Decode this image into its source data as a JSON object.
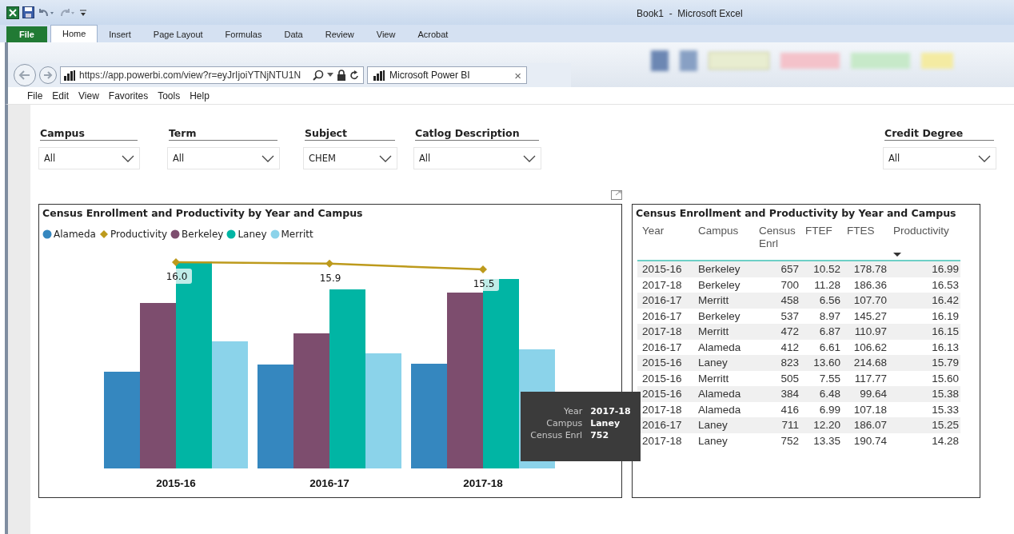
{
  "window": {
    "title": "Book1  -  Microsoft Excel"
  },
  "ribbon_tabs": [
    {
      "label": "File",
      "kind": "file",
      "selected": false
    },
    {
      "label": "Home",
      "kind": "tab",
      "selected": true
    },
    {
      "label": "Insert",
      "kind": "tab",
      "selected": false
    },
    {
      "label": "Page Layout",
      "kind": "tab",
      "selected": false
    },
    {
      "label": "Formulas",
      "kind": "tab",
      "selected": false
    },
    {
      "label": "Data",
      "kind": "tab",
      "selected": false
    },
    {
      "label": "Review",
      "kind": "tab",
      "selected": false
    },
    {
      "label": "View",
      "kind": "tab",
      "selected": false
    },
    {
      "label": "Acrobat",
      "kind": "tab",
      "selected": false
    }
  ],
  "browser": {
    "address": "https://app.powerbi.com/view?r=eyJrIjoiYTNjNTU1N",
    "tab_title": "Microsoft Power BI",
    "tab_close": "×",
    "menu": [
      "File",
      "Edit",
      "View",
      "Favorites",
      "Tools",
      "Help"
    ]
  },
  "slicers": [
    {
      "label": "Campus",
      "value": "All"
    },
    {
      "label": "Term",
      "value": "All"
    },
    {
      "label": "Subject",
      "value": "CHEM"
    },
    {
      "label": "Catlog Description",
      "value": "All"
    },
    {
      "label": "Credit Degree",
      "value": "All"
    }
  ],
  "chart": {
    "bar_legend": [
      {
        "label": "Alameda",
        "color": "#3587bf"
      },
      {
        "label": "Berkeley",
        "color": "#7d4d6e"
      },
      {
        "label": "Laney",
        "color": "#01b5a4"
      },
      {
        "label": "Merritt",
        "color": "#8bd3ea"
      }
    ],
    "chart_data": {
      "type": "line",
      "title": "Census Enrollment and Productivity by Year and Campus",
      "categories": [
        "2015-16",
        "2016-17",
        "2017-18"
      ],
      "series": [
        {
          "name": "Productivity",
          "color": "#bd9a1c",
          "marker": "diamond",
          "values": [
            16.0,
            15.9,
            15.5
          ],
          "value_labels": [
            "16.0",
            "15.9",
            "15.5"
          ]
        }
      ]
    }
  },
  "tooltip": [
    {
      "label": "Year",
      "value": "2017-18"
    },
    {
      "label": "Campus",
      "value": "Laney"
    },
    {
      "label": "Census Enrl",
      "value": "752"
    }
  ],
  "table": {
    "title": "Census Enrollment and Productivity by Year and Campus",
    "columns": [
      {
        "label": "Year",
        "sorted": false
      },
      {
        "label": "Campus",
        "sorted": false
      },
      {
        "label": "Census Enrl",
        "sorted": false
      },
      {
        "label": "FTEF",
        "sorted": false
      },
      {
        "label": "FTES",
        "sorted": false
      },
      {
        "label": "Productivity",
        "sorted": true
      }
    ],
    "rows": [
      [
        "2015-16",
        "Berkeley",
        "657",
        "10.52",
        "178.78",
        "16.99"
      ],
      [
        "2017-18",
        "Berkeley",
        "700",
        "11.28",
        "186.36",
        "16.53"
      ],
      [
        "2016-17",
        "Merritt",
        "458",
        "6.56",
        "107.70",
        "16.42"
      ],
      [
        "2016-17",
        "Berkeley",
        "537",
        "8.97",
        "145.27",
        "16.19"
      ],
      [
        "2017-18",
        "Merritt",
        "472",
        "6.87",
        "110.97",
        "16.15"
      ],
      [
        "2016-17",
        "Alameda",
        "412",
        "6.61",
        "106.62",
        "16.13"
      ],
      [
        "2015-16",
        "Laney",
        "823",
        "13.60",
        "214.68",
        "15.79"
      ],
      [
        "2015-16",
        "Merritt",
        "505",
        "7.55",
        "117.77",
        "15.60"
      ],
      [
        "2015-16",
        "Alameda",
        "384",
        "6.48",
        "99.64",
        "15.38"
      ],
      [
        "2017-18",
        "Alameda",
        "416",
        "6.99",
        "107.18",
        "15.33"
      ],
      [
        "2016-17",
        "Laney",
        "711",
        "12.20",
        "186.07",
        "15.25"
      ],
      [
        "2017-18",
        "Laney",
        "752",
        "13.35",
        "190.74",
        "14.28"
      ]
    ]
  }
}
